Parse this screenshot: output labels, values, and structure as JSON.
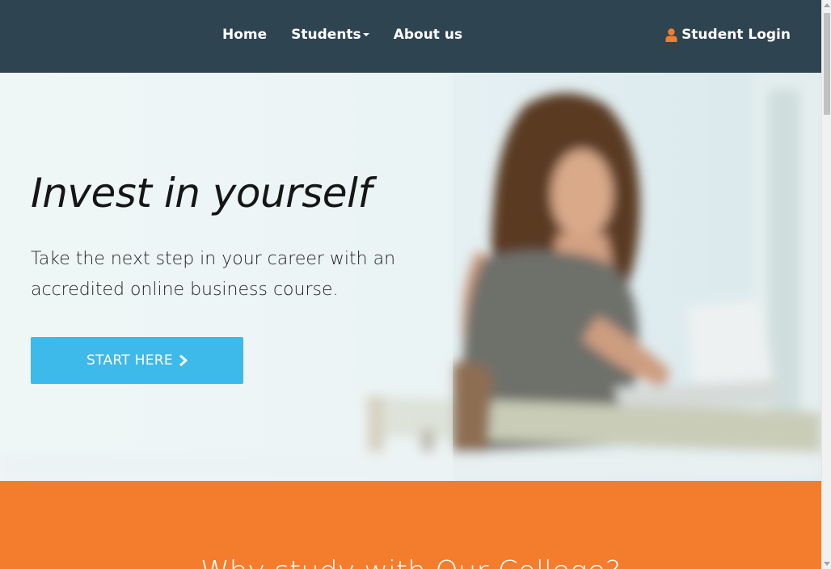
{
  "nav": {
    "items": [
      {
        "label": "Home"
      },
      {
        "label": "Students"
      },
      {
        "label": "About us"
      }
    ],
    "login_label": "Student Login",
    "background": "#2e4451",
    "icon_color": "#f47d2d"
  },
  "hero": {
    "title": "Invest in yourself",
    "text": "Take the next step in your career with an accredited online business course.",
    "cta_label": "START HERE",
    "cta_color": "#3db9ea",
    "cta_icon": "chevron-right-icon"
  },
  "section": {
    "title": "Why study with Our College?",
    "background": "#f47d2d"
  }
}
